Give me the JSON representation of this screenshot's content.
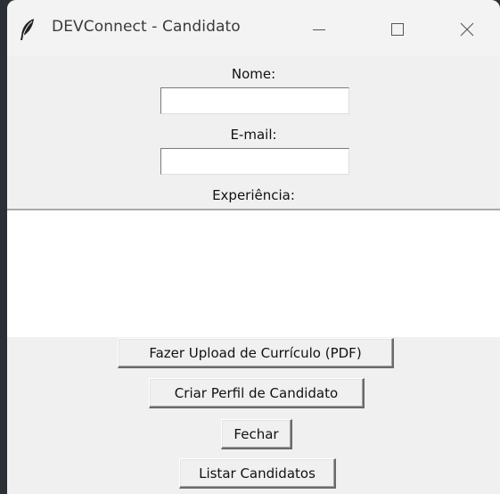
{
  "window": {
    "title": "DEVConnect - Candidato",
    "icon": "feather-icon",
    "controls": [
      "minimize-icon",
      "maximize-icon",
      "close-icon"
    ]
  },
  "form": {
    "name_label": "Nome:",
    "name_value": "",
    "email_label": "E-mail:",
    "email_value": "",
    "experience_label": "Experiência:",
    "experience_value": ""
  },
  "buttons": {
    "upload_label": "Fazer Upload de Currículo (PDF)",
    "create_label": "Criar Perfil de Candidato",
    "close_label": "Fechar",
    "list_label": "Listar Candidatos"
  }
}
